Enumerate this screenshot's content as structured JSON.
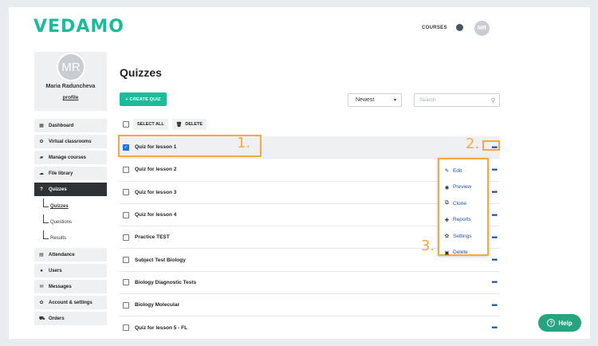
{
  "header": {
    "logo": "VEDAMO",
    "nav_courses": "COURSES",
    "avatar_initials": "MR"
  },
  "profile": {
    "initials": "MR",
    "name": "Maria Raduncheva",
    "link": "profile"
  },
  "sidebar": {
    "items": [
      {
        "label": "Dashboard",
        "icon": "grid-icon"
      },
      {
        "label": "Virtual classrooms",
        "icon": "gear-icon"
      },
      {
        "label": "Manage courses",
        "icon": "book-icon"
      },
      {
        "label": "File library",
        "icon": "cloud-icon"
      },
      {
        "label": "Quizzes",
        "icon": "question-icon"
      },
      {
        "label": "Attendance",
        "icon": "clipboard-icon"
      },
      {
        "label": "Users",
        "icon": "users-icon"
      },
      {
        "label": "Messages",
        "icon": "envelope-icon"
      },
      {
        "label": "Account & settings",
        "icon": "gear-icon"
      },
      {
        "label": "Orders",
        "icon": "cart-icon"
      }
    ],
    "quiz_subitems": [
      "Quizzes",
      "Questions",
      "Results"
    ]
  },
  "main": {
    "title": "Quizzes",
    "create_button": "+ CREATE QUIZ",
    "sort_value": "Newest",
    "search_placeholder": "Search",
    "select_all": "SELECT ALL",
    "delete": "DELETE",
    "quizzes": [
      "Quiz for lesson 1",
      "Quiz for lesson 2",
      "Quiz for lesson 3",
      "Quiz for lesson 4",
      "Practice TEST",
      "Subject Test Biology",
      "Biology Diagnostic Tests",
      "Biology Molecular",
      "Quiz for lesson 5 - FL"
    ]
  },
  "menu": {
    "items": [
      {
        "label": "Edit",
        "icon": "pencil-icon"
      },
      {
        "label": "Preview",
        "icon": "eye-icon"
      },
      {
        "label": "Clone",
        "icon": "copy-icon"
      },
      {
        "label": "Reports",
        "icon": "plus-icon"
      },
      {
        "label": "Settings",
        "icon": "gear-icon"
      },
      {
        "label": "Delete",
        "icon": "trash-icon"
      }
    ]
  },
  "annotations": {
    "a1": "1.",
    "a2": "2.",
    "a3": "3."
  },
  "help": {
    "label": "Help"
  },
  "colors": {
    "brand": "#1bbc9b",
    "highlight": "#f5a945",
    "link": "#1a4fb5",
    "help": "#27a37f"
  }
}
